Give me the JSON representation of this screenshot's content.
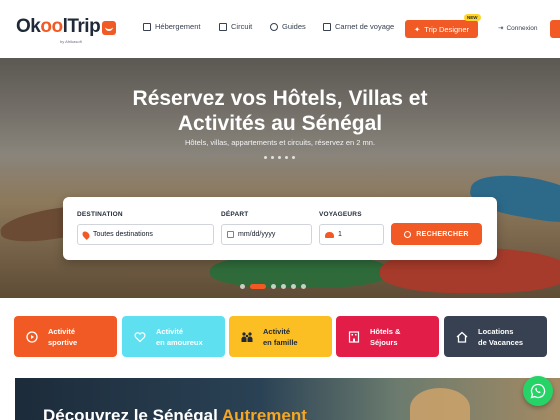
{
  "header": {
    "logo_prefix": "Ok",
    "logo_oo": "oo",
    "logo_l": "l",
    "logo_trip": "Trip",
    "logo_tagline": "by Afrikasoft",
    "nav": [
      {
        "label": "Hébergement",
        "icon": "building-icon"
      },
      {
        "label": "Circuit",
        "icon": "map-icon"
      },
      {
        "label": "Guides",
        "icon": "users-icon"
      },
      {
        "label": "Carnet de voyage",
        "icon": "book-icon"
      }
    ],
    "trip_designer_label": "Trip Designer",
    "new_badge": "NEW",
    "login_label": "Connexion"
  },
  "hero": {
    "title_line1": "Réservez vos Hôtels, Villas et",
    "title_line2": "Activités au Sénégal",
    "subtitle": "Hôtels, villas, appartements et circuits, réservez en 2 mn."
  },
  "search": {
    "destination_label": "DESTINATION",
    "destination_value": "Toutes destinations",
    "departure_label": "DÉPART",
    "departure_placeholder": "mm/dd/yyyy",
    "travelers_label": "VOYAGEURS",
    "travelers_value": "1",
    "search_button": "RECHERCHER"
  },
  "carousel": {
    "count": 6,
    "active_index": 1
  },
  "categories": [
    {
      "label": "Activité\nsportive",
      "bg": "#f15a24",
      "fg": "#ffffff",
      "icon": "play-circle-icon"
    },
    {
      "label": "Activité\nen amoureux",
      "bg": "#5ee0f0",
      "fg": "#ffffff",
      "icon": "heart-icon"
    },
    {
      "label": "Activité\nen famille",
      "bg": "#fbbf24",
      "fg": "#1f2937",
      "icon": "family-icon"
    },
    {
      "label": "Hôtels &\nSéjours",
      "bg": "#e11d48",
      "fg": "#ffffff",
      "icon": "hotel-icon"
    },
    {
      "label": "Locations\nde Vacances",
      "bg": "#374151",
      "fg": "#ffffff",
      "icon": "house-icon"
    }
  ],
  "banner": {
    "title_part1": "Découvrez le Sénégal ",
    "title_part2": "Autrement"
  },
  "colors": {
    "accent": "#f15a24",
    "whatsapp": "#25d366"
  }
}
